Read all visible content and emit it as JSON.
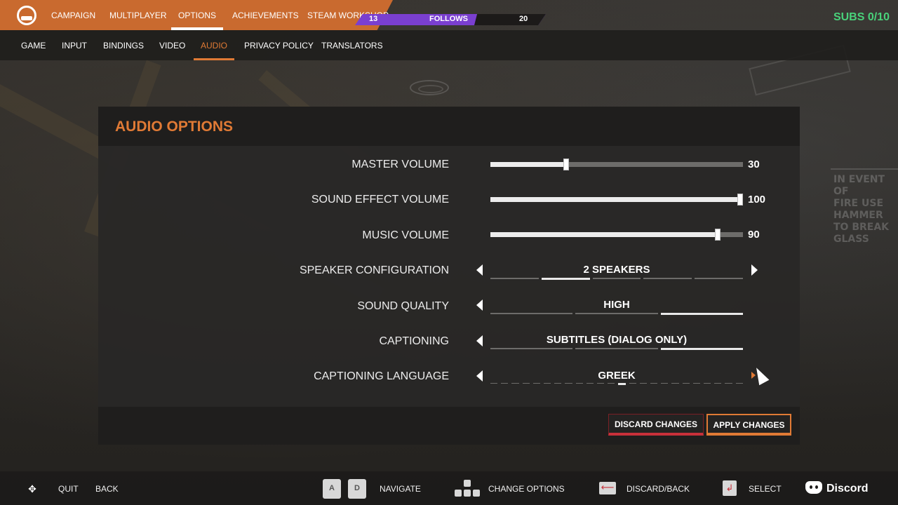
{
  "nav": {
    "tabs": [
      "CAMPAIGN",
      "MULTIPLAYER",
      "OPTIONS",
      "ACHIEVEMENTS",
      "STEAM WORKSHOP"
    ],
    "active_tab": "OPTIONS",
    "subtabs": [
      "GAME",
      "INPUT",
      "BINDINGS",
      "VIDEO",
      "AUDIO",
      "PRIVACY POLICY",
      "TRANSLATORS"
    ],
    "active_subtab": "AUDIO"
  },
  "overlay": {
    "follows_left": "13",
    "follows_label": "FOLLOWS",
    "follows_right": "20",
    "subs": "SUBS 0/10"
  },
  "panel": {
    "title": "AUDIO OPTIONS",
    "sliders": [
      {
        "label": "MASTER VOLUME",
        "value": 30,
        "display": "30"
      },
      {
        "label": "SOUND EFFECT VOLUME",
        "value": 100,
        "display": "100"
      },
      {
        "label": "MUSIC VOLUME",
        "value": 90,
        "display": "90"
      }
    ],
    "options": [
      {
        "label": "SPEAKER CONFIGURATION",
        "value": "2 SPEAKERS"
      },
      {
        "label": "SOUND QUALITY",
        "value": "HIGH"
      },
      {
        "label": "CAPTIONING",
        "value": "SUBTITLES (DIALOG ONLY)"
      },
      {
        "label": "CAPTIONING LANGUAGE",
        "value": "GREEK"
      }
    ],
    "discard_label": "DISCARD CHANGES",
    "apply_label": "APPLY CHANGES"
  },
  "hints": {
    "quit": "QUIT",
    "back": "BACK",
    "key_a": "A",
    "key_d": "D",
    "navigate": "NAVIGATE",
    "change_options": "CHANGE OPTIONS",
    "discard_back": "DISCARD/BACK",
    "select": "SELECT",
    "discord": "Discord"
  },
  "colors": {
    "accent": "#e07a35",
    "topbar": "#c96a2f",
    "discard": "#c8303a",
    "subs": "#49d17a",
    "follows": "#7a3fd0"
  },
  "icons": {
    "logo": "game-logo-icon",
    "dpad": "dpad-icon",
    "grid": "arrow-keys-icon",
    "back_key": "backspace-key-icon",
    "enter_key": "enter-key-icon",
    "discord": "discord-icon",
    "cursor": "mouse-cursor-icon"
  }
}
